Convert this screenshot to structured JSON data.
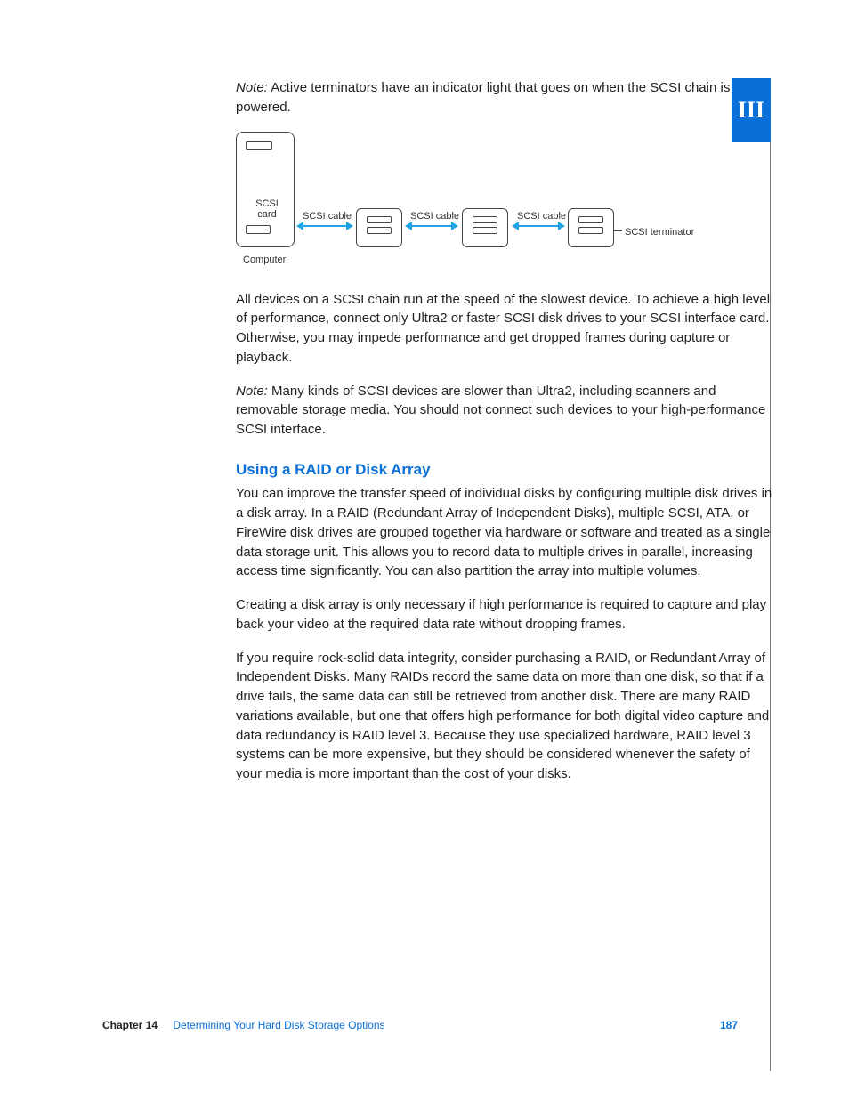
{
  "tab": {
    "part_label": "III"
  },
  "note1": {
    "label": "Note:",
    "text": "Active terminators have an indicator light that goes on when the SCSI chain is powered."
  },
  "diagram": {
    "card_label_line1": "SCSI",
    "card_label_line2": "card",
    "cable_label": "SCSI cable",
    "terminator_label": "SCSI terminator",
    "computer_label": "Computer"
  },
  "para_chain": "All devices on a SCSI chain run at the speed of the slowest device. To achieve a high level of performance, connect only Ultra2 or faster SCSI disk drives to your SCSI interface card. Otherwise, you may impede performance and get dropped frames during capture or playback.",
  "note2": {
    "label": "Note:",
    "text": "Many kinds of SCSI devices are slower than Ultra2, including scanners and removable storage media. You should not connect such devices to your high-performance SCSI interface."
  },
  "section_heading": "Using a RAID or Disk Array",
  "para_raid1": "You can improve the transfer speed of individual disks by configuring multiple disk drives in a disk array. In a RAID (Redundant Array of Independent Disks), multiple SCSI, ATA, or FireWire disk drives are grouped together via hardware or software and treated as a single data storage unit. This allows you to record data to multiple drives in parallel, increasing access time significantly. You can also partition the array into multiple volumes.",
  "para_raid2": "Creating a disk array is only necessary if high performance is required to capture and play back your video at the required data rate without dropping frames.",
  "para_raid3": "If you require rock-solid data integrity, consider purchasing a RAID, or Redundant Array of Independent Disks. Many RAIDs record the same data on more than one disk, so that if a drive fails, the same data can still be retrieved from another disk. There are many RAID variations available, but one that offers high performance for both digital video capture and data redundancy is RAID level 3. Because they use specialized hardware, RAID level 3 systems can be more expensive, but they should be considered whenever the safety of your media is more important than the cost of your disks.",
  "footer": {
    "chapter_label": "Chapter 14",
    "chapter_title": "Determining Your Hard Disk Storage Options",
    "page_number": "187"
  }
}
